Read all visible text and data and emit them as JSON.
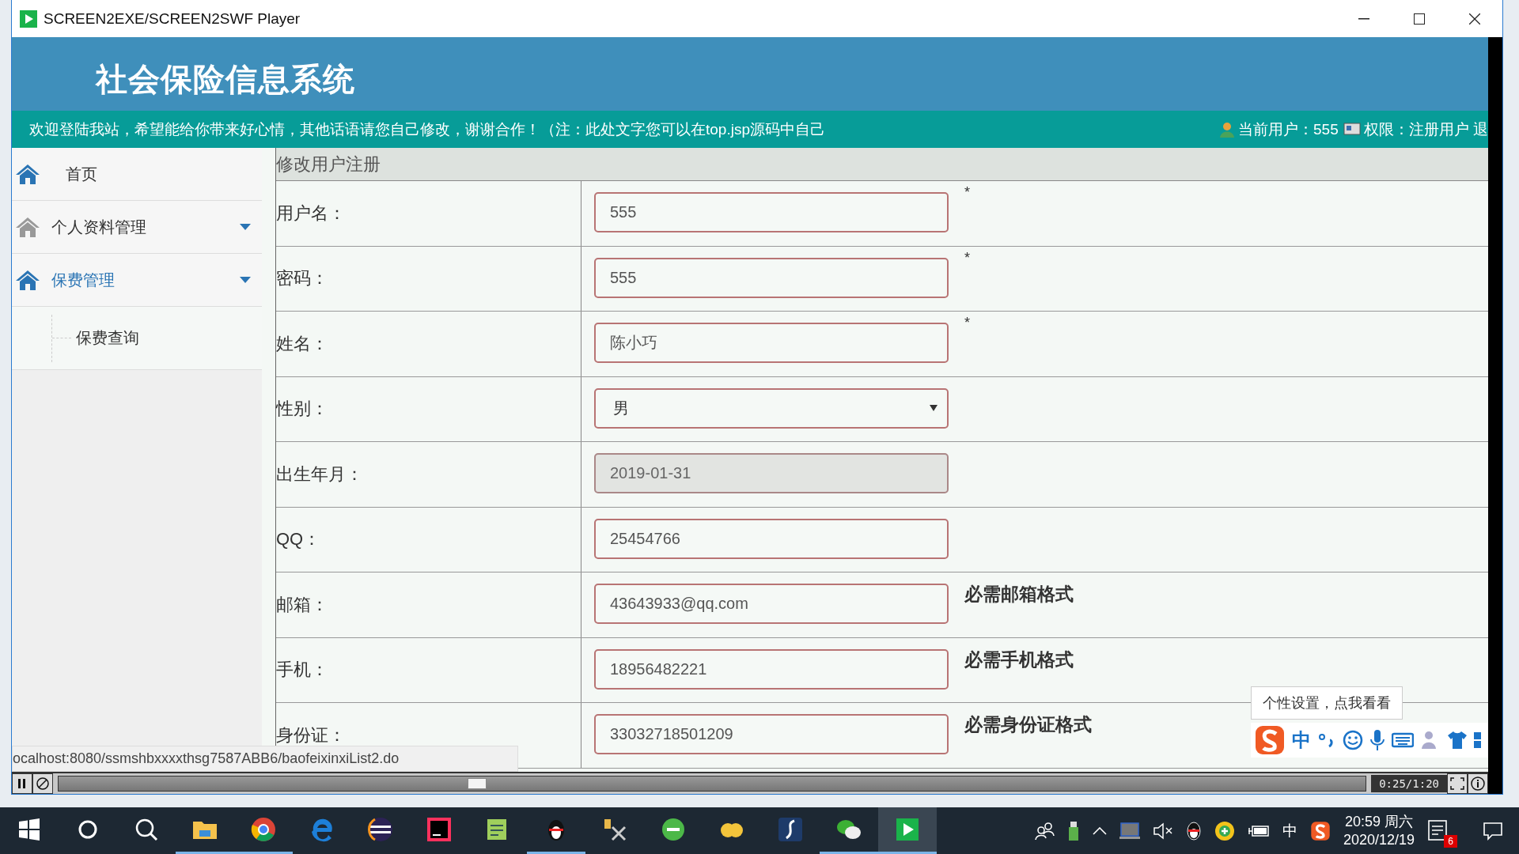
{
  "window": {
    "title": "SCREEN2EXE/SCREEN2SWF Player"
  },
  "header": {
    "title": "社会保险信息系统",
    "marquee": "欢迎登陆我站，希望能给你带来好心情，其他话语请您自己修改，谢谢合作！（注：此处文字您可以在top.jsp源码中自己",
    "user": "当前用户：555",
    "role": "权限：注册用户 退"
  },
  "sidebar": {
    "items": [
      {
        "label": "首页",
        "kind": "link",
        "selected": false
      },
      {
        "label": "个人资料管理",
        "kind": "group",
        "selected": false
      },
      {
        "label": "保费管理",
        "kind": "group",
        "selected": true,
        "children": [
          {
            "label": "保费查询"
          }
        ]
      }
    ]
  },
  "form": {
    "title": "修改用户注册",
    "rows": [
      {
        "label": "用户名：",
        "kind": "text",
        "value": "555",
        "mark": "*",
        "disabled": false
      },
      {
        "label": "密码：",
        "kind": "text",
        "value": "555",
        "mark": "*",
        "disabled": false
      },
      {
        "label": "姓名：",
        "kind": "text",
        "value": "陈小巧",
        "mark": "*",
        "disabled": false
      },
      {
        "label": "性别：",
        "kind": "select",
        "value": "男",
        "disabled": false
      },
      {
        "label": "出生年月：",
        "kind": "text",
        "value": "2019-01-31",
        "disabled": true
      },
      {
        "label": "QQ：",
        "kind": "text",
        "value": "25454766",
        "disabled": false
      },
      {
        "label": "邮箱：",
        "kind": "text",
        "value": "43643933@qq.com",
        "disabled": false,
        "hint": "必需邮箱格式"
      },
      {
        "label": "手机：",
        "kind": "text",
        "value": "18956482221",
        "disabled": false,
        "hint": "必需手机格式"
      },
      {
        "label": "身份证：",
        "kind": "text",
        "value": "33032718501209",
        "disabled": false,
        "hint": "必需身份证格式"
      }
    ]
  },
  "status_url": "ocalhost:8080/ssmshbxxxxthsg7587ABB6/baofeixinxiList2.do",
  "ime": {
    "tooltip": "个性设置，点我看看",
    "mode": "中"
  },
  "player": {
    "time": "0:25/1:20",
    "level": 0.32
  },
  "taskbar": {
    "apps": [
      {
        "running": false,
        "selected": false
      },
      {
        "running": false,
        "selected": false
      },
      {
        "running": false,
        "selected": false
      },
      {
        "running": true,
        "selected": false
      },
      {
        "running": true,
        "selected": false
      },
      {
        "running": false,
        "selected": false
      },
      {
        "running": false,
        "selected": false
      },
      {
        "running": false,
        "selected": false
      },
      {
        "running": false,
        "selected": false
      },
      {
        "running": true,
        "selected": false
      },
      {
        "running": false,
        "selected": false
      },
      {
        "running": false,
        "selected": false
      },
      {
        "running": false,
        "selected": false
      },
      {
        "running": false,
        "selected": false
      },
      {
        "running": true,
        "selected": false
      },
      {
        "running": true,
        "selected": true
      }
    ],
    "lang": "中",
    "time": "20:59 周六",
    "date": "2020/12/19",
    "notifications": "6"
  }
}
